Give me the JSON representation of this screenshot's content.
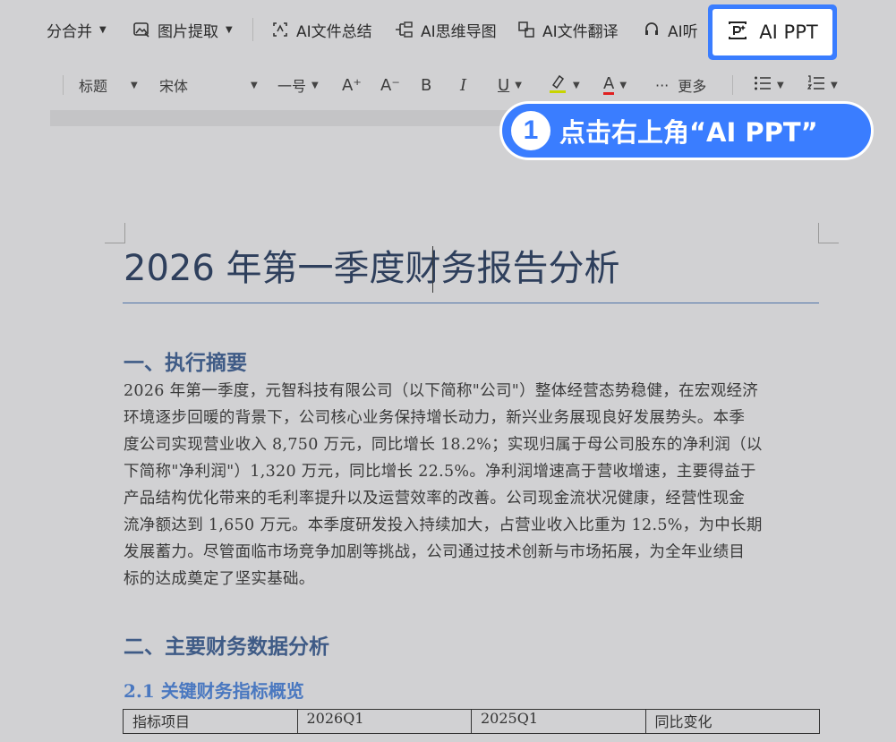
{
  "toolbar_top": {
    "items": [
      {
        "label": "分合并",
        "icon": "merge-icon",
        "dropdown": true
      },
      {
        "label": "图片提取",
        "icon": "image-extract-icon",
        "dropdown": true
      },
      {
        "label": "AI文件总结",
        "icon": "ai-summary-icon"
      },
      {
        "label": "AI思维导图",
        "icon": "ai-mindmap-icon"
      },
      {
        "label": "AI文件翻译",
        "icon": "ai-translate-icon"
      },
      {
        "label": "AI听",
        "icon": "ai-listen-icon"
      }
    ],
    "ai_ppt": {
      "label": "AI PPT",
      "icon": "ai-ppt-icon",
      "highlight_color": "#3a7dff"
    }
  },
  "toolbar_format": {
    "style": "标题",
    "font": "宋体",
    "size": "一号",
    "more": "更多"
  },
  "callout": {
    "number": "1",
    "text": "点击右上角“AI PPT”",
    "color": "#3a7dff"
  },
  "document": {
    "title": "2026 年第一季度财务报告分析",
    "section1_heading": "一、执行摘要",
    "section1_lines": [
      "2026 年第一季度，元智科技有限公司（以下简称\"公司\"）整体经营态势稳健，在宏观经济",
      "环境逐步回暖的背景下，公司核心业务保持增长动力，新兴业务展现良好发展势头。本季",
      "度公司实现营业收入 8,750 万元，同比增长 18.2%；实现归属于母公司股东的净利润（以",
      "下简称\"净利润\"）1,320 万元，同比增长 22.5%。净利润增速高于营收增速，主要得益于",
      "产品结构优化带来的毛利率提升以及运营效率的改善。公司现金流状况健康，经营性现金",
      "流净额达到 1,650 万元。本季度研发投入持续加大，占营业收入比重为 12.5%，为中长期",
      "发展蓄力。尽管面临市场竞争加剧等挑战，公司通过技术创新与市场拓展，为全年业绩目",
      "标的达成奠定了坚实基础。"
    ],
    "section2_heading": "二、主要财务数据分析",
    "section2_1_heading": "2.1 关键财务指标概览",
    "table_headers": [
      "指标项目",
      "2026Q1",
      "2025Q1",
      "同比变化"
    ]
  }
}
